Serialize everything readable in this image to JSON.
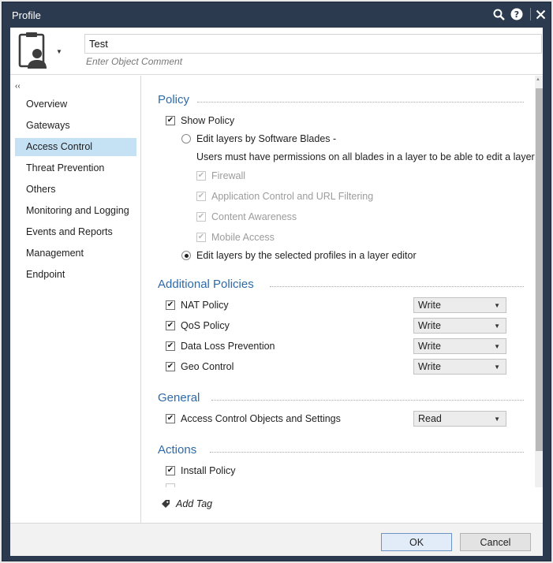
{
  "window": {
    "title": "Profile",
    "icons": [
      "search-icon",
      "help-icon",
      "close-icon"
    ]
  },
  "header": {
    "name_value": "Test",
    "comment_placeholder": "Enter Object Comment"
  },
  "sidebar": {
    "collapse_glyph": "‹‹",
    "items": [
      {
        "label": "Overview"
      },
      {
        "label": "Gateways"
      },
      {
        "label": "Access Control"
      },
      {
        "label": "Threat Prevention"
      },
      {
        "label": "Others"
      },
      {
        "label": "Monitoring and Logging"
      },
      {
        "label": "Events and Reports"
      },
      {
        "label": "Management"
      },
      {
        "label": "Endpoint"
      }
    ],
    "active_index": 2
  },
  "policy": {
    "title": "Policy",
    "show_policy": "Show Policy",
    "edit_by_blades": "Edit layers by Software Blades -",
    "blades_note": "Users must have permissions on all blades in a layer to be able to edit a layer",
    "blades": [
      {
        "label": "Firewall"
      },
      {
        "label": "Application Control and URL Filtering"
      },
      {
        "label": "Content Awareness"
      },
      {
        "label": "Mobile Access"
      }
    ],
    "edit_by_profiles": "Edit layers by the selected profiles in a layer editor"
  },
  "additional_policies": {
    "title": "Additional Policies",
    "rows": [
      {
        "label": "NAT Policy",
        "value": "Write"
      },
      {
        "label": "QoS Policy",
        "value": "Write"
      },
      {
        "label": "Data Loss Prevention",
        "value": "Write"
      },
      {
        "label": "Geo Control",
        "value": "Write"
      }
    ]
  },
  "general": {
    "title": "General",
    "rows": [
      {
        "label": "Access Control Objects and Settings",
        "value": "Read"
      }
    ]
  },
  "actions": {
    "title": "Actions",
    "rows": [
      {
        "label": "Install Policy"
      }
    ]
  },
  "tag": {
    "label": "Add Tag"
  },
  "footer": {
    "ok": "OK",
    "cancel": "Cancel"
  },
  "colors": {
    "title_bar": "#2b3a4f",
    "section_title": "#2e6aa8",
    "active_nav": "#c5e2f5"
  }
}
